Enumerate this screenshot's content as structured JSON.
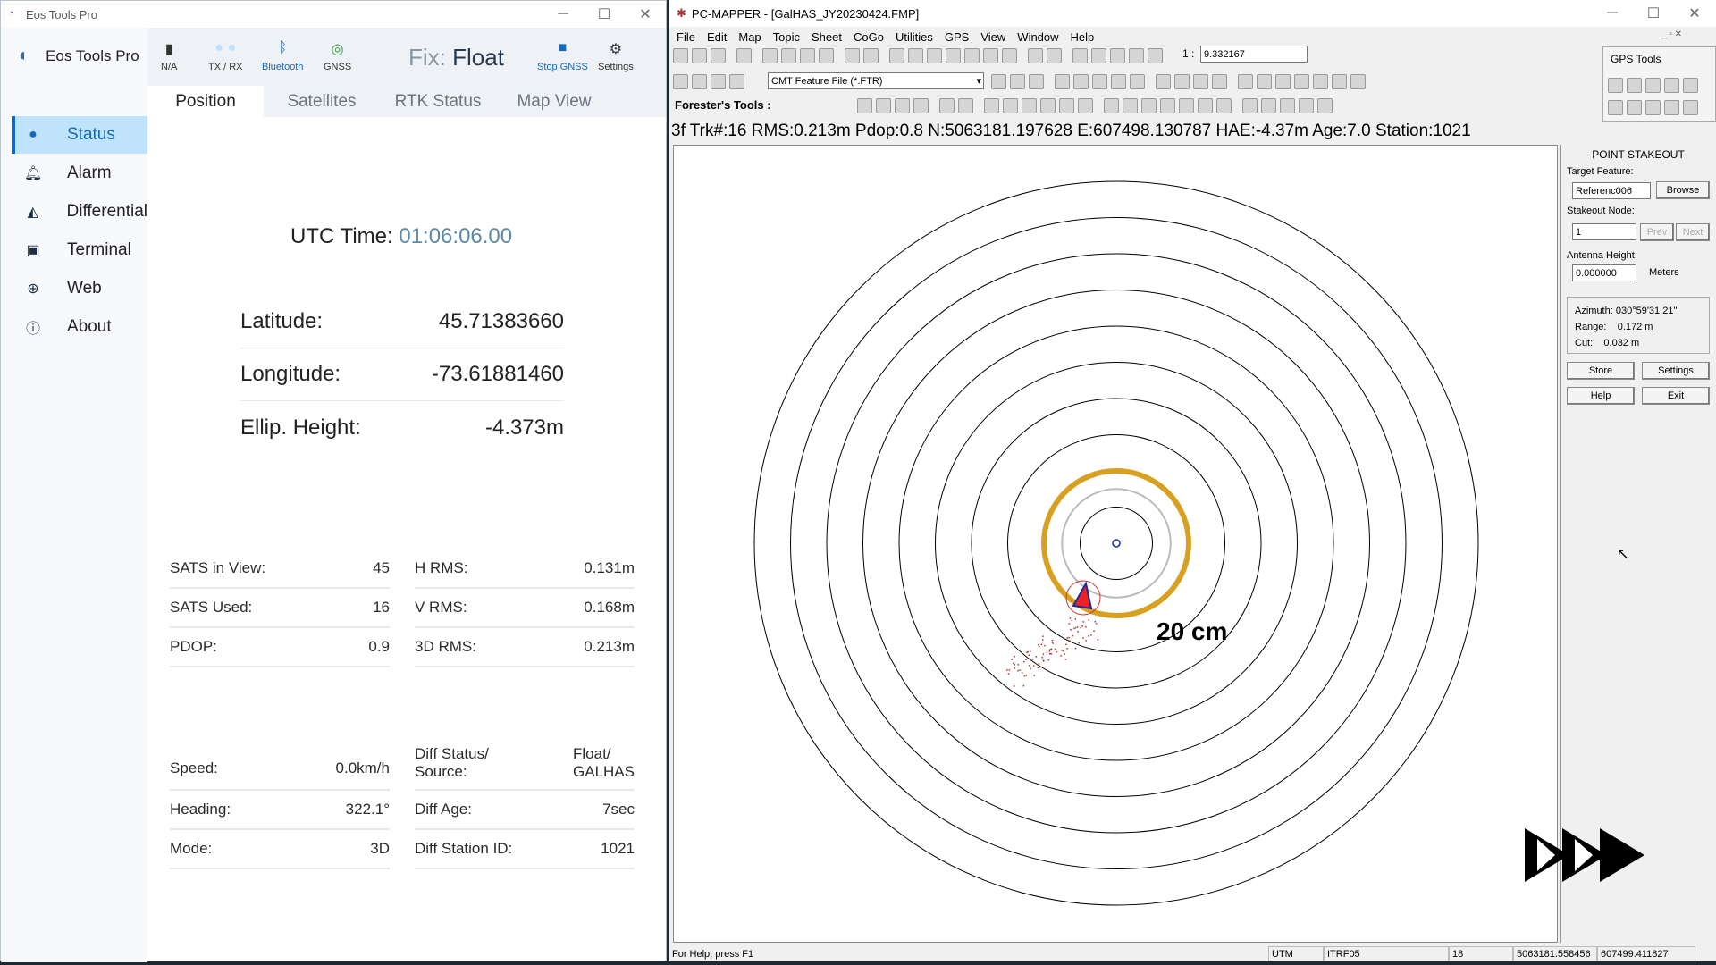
{
  "eos": {
    "window_title": "Eos Tools Pro",
    "brand": "Eos Tools Pro",
    "sidebar": [
      {
        "label": "Status",
        "icon": "globe-filled-icon",
        "active": true
      },
      {
        "label": "Alarm",
        "icon": "bell-icon"
      },
      {
        "label": "Differential",
        "icon": "chart-line-icon"
      },
      {
        "label": "Terminal",
        "icon": "terminal-icon"
      },
      {
        "label": "Web",
        "icon": "globe-icon"
      },
      {
        "label": "About",
        "icon": "info-icon"
      }
    ],
    "header": {
      "battery": "N/A",
      "txrx": "TX / RX",
      "bluetooth": "Bluetooth",
      "gnss": "GNSS",
      "fix_label": "Fix:",
      "fix_value": "Float",
      "stop": "Stop GNSS",
      "settings": "Settings"
    },
    "tabs": [
      "Position",
      "Satellites",
      "RTK Status",
      "Map View"
    ],
    "utc_label": "UTC Time:",
    "utc_value": "01:06:06.00",
    "position": [
      {
        "label": "Latitude:",
        "value": "45.71383660"
      },
      {
        "label": "Longitude:",
        "value": "-73.61881460"
      },
      {
        "label": "Ellip. Height:",
        "value": "-4.373m"
      }
    ],
    "stats_left": [
      {
        "label": "SATS in View:",
        "value": "45"
      },
      {
        "label": "SATS Used:",
        "value": "16"
      },
      {
        "label": "PDOP:",
        "value": "0.9"
      }
    ],
    "stats_right": [
      {
        "label": "H RMS:",
        "value": "0.131m"
      },
      {
        "label": "V RMS:",
        "value": "0.168m"
      },
      {
        "label": "3D RMS:",
        "value": "0.213m"
      }
    ],
    "motion_left": [
      {
        "label": "Speed:",
        "value": "0.0km/h"
      },
      {
        "label": "Heading:",
        "value": "322.1°"
      },
      {
        "label": "Mode:",
        "value": "3D"
      }
    ],
    "diff": {
      "status_label1": "Diff Status/",
      "status_label2": "Source:",
      "status_value1": "Float/",
      "status_value2": "GALHAS",
      "age_label": "Diff Age:",
      "age_value": "7sec",
      "station_label": "Diff Station ID:",
      "station_value": "1021"
    },
    "accent": "#1669b8"
  },
  "pcm": {
    "window_title": "PC-MAPPER - [GalHAS_JY20230424.FMP]",
    "menu": [
      "File",
      "Edit",
      "Map",
      "Topic",
      "Sheet",
      "CoGo",
      "Utilities",
      "GPS",
      "View",
      "Window",
      "Help"
    ],
    "scale_prefix": "1 :",
    "scale_value": "9.332167",
    "feature_file": "CMT Feature File (*.FTR)",
    "foresters": "Forester's Tools :",
    "status_line": "3f Trk#:16  RMS:0.213m  Pdop:0.8  N:5063181.197628  E:607498.130787  HAE:-4.37m  Age:7.0  Station:1021",
    "map_label": "20 cm",
    "ring_color": "#d8a020",
    "gps_tools": "GPS Tools",
    "stakeout": {
      "title": "POINT STAKEOUT",
      "target_label": "Target Feature:",
      "target_value": "Referenc006",
      "browse": "Browse",
      "node_label": "Stakeout Node:",
      "node_value": "1",
      "prev": "Prev",
      "next": "Next",
      "ant_label": "Antenna Height:",
      "ant_value": "0.000000",
      "ant_unit": "Meters",
      "azimuth": "Azimuth: 030°59'31.21''",
      "range": "Range:    0.172 m",
      "cut": "Cut:    0.032 m",
      "store": "Store",
      "settings": "Settings",
      "help": "Help",
      "exit": "Exit"
    },
    "statusbar": {
      "help": "For Help, press F1",
      "proj": "UTM",
      "datum": "ITRF05",
      "zone": "18",
      "north": "5063181.558456",
      "east": "607499.411827"
    }
  }
}
